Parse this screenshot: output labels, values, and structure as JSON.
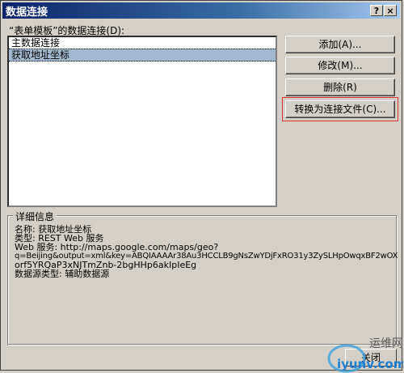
{
  "window": {
    "title": "数据连接",
    "help_label": "?",
    "close_label": "×"
  },
  "connections": {
    "label": "“表单模板”的数据连接(D):",
    "items": [
      {
        "label": "主数据连接",
        "selected": false
      },
      {
        "label": "获取地址坐标",
        "selected": true
      }
    ]
  },
  "buttons": {
    "add": "添加(A)...",
    "modify": "修改(M)...",
    "delete": "删除(R)",
    "convert": "转换为连接文件(C)..."
  },
  "details": {
    "title": "详细信息",
    "lines": [
      "名称: 获取地址坐标",
      "类型: REST Web 服务",
      "Web 服务: http://maps.google.com/maps/geo?",
      "q=Beijing&output=xml&key=ABQIAAAAr38Au3HCCLB9gNsZwYDjFxRO31y3ZySLHpOwqxBF2wOX",
      "orf5YRQaP3xNJTmZnb-2bgHHp6akIpIeEg",
      "数据源类型: 辅助数据源"
    ]
  },
  "footer": {
    "close_label": "关闭"
  },
  "watermark": {
    "text1": "运维网",
    "text2": "iyunv.com"
  }
}
